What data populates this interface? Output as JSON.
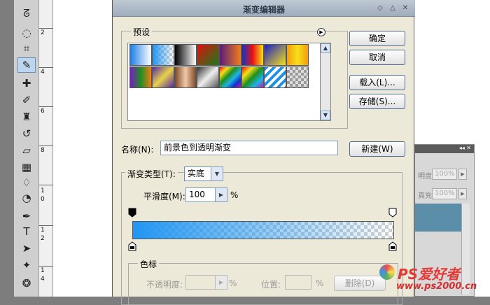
{
  "dialog": {
    "title": "渐变编辑器",
    "presets_label": "预设",
    "buttons": {
      "ok": "确定",
      "cancel": "取消",
      "load": "载入(L)...",
      "save": "存储(S)...",
      "new": "新建(W)"
    },
    "name_label": "名称(N):",
    "name_value": "前景色到透明渐变",
    "type_label": "渐变类型(T):",
    "type_value": "实底",
    "smoothness_label": "平滑度(M):",
    "smoothness_value": "100",
    "percent": "%",
    "stops_label": "色标",
    "opacity_label": "不透明度:",
    "location_label": "位置:",
    "delete_button": "删除(D)"
  },
  "panel": {
    "opacity_label": "明度:",
    "opacity_value": "100%",
    "fill_label": "真充:",
    "fill_value": "100%"
  },
  "ruler": [
    "2",
    "4",
    "6",
    "8",
    "1",
    "0",
    "1",
    "2",
    "1",
    "4"
  ],
  "watermark": {
    "title": "PS爱好者",
    "url": "www.ps2000.cn"
  },
  "colors": {
    "gradient_start": "#2196f3"
  }
}
